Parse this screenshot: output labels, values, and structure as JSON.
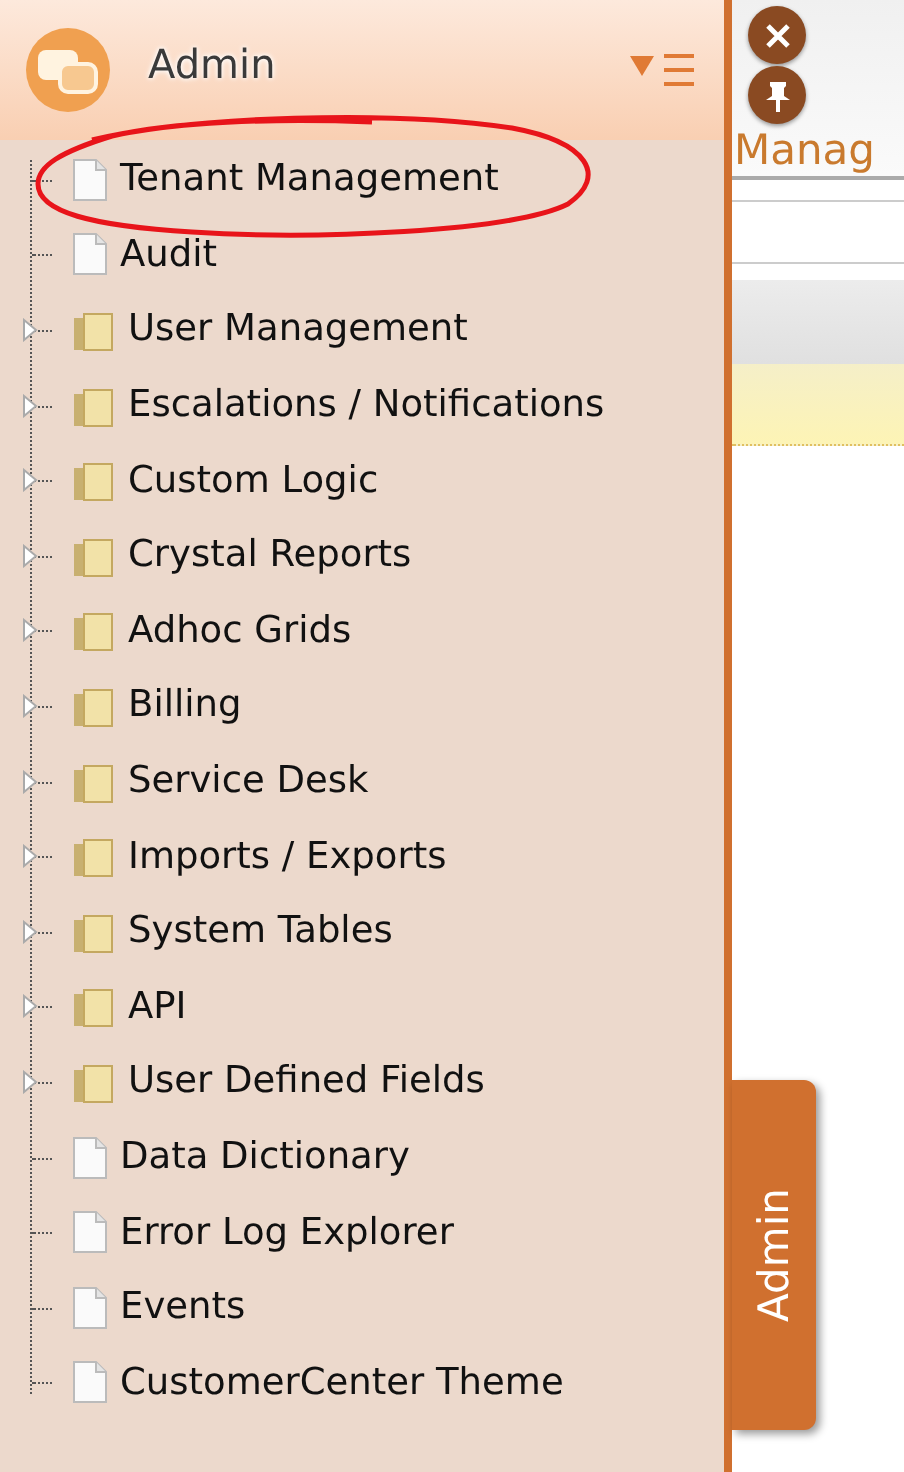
{
  "panel": {
    "title": "Admin",
    "tree": [
      {
        "label": "Tenant Management",
        "kind": "page"
      },
      {
        "label": "Audit",
        "kind": "page"
      },
      {
        "label": "User Management",
        "kind": "folder"
      },
      {
        "label": "Escalations / Notifications",
        "kind": "folder"
      },
      {
        "label": "Custom Logic",
        "kind": "folder"
      },
      {
        "label": "Crystal Reports",
        "kind": "folder"
      },
      {
        "label": "Adhoc Grids",
        "kind": "folder"
      },
      {
        "label": "Billing",
        "kind": "folder"
      },
      {
        "label": "Service Desk",
        "kind": "folder"
      },
      {
        "label": "Imports / Exports",
        "kind": "folder"
      },
      {
        "label": "System Tables",
        "kind": "folder"
      },
      {
        "label": "API",
        "kind": "folder"
      },
      {
        "label": "User Defined Fields",
        "kind": "folder"
      },
      {
        "label": "Data Dictionary",
        "kind": "page"
      },
      {
        "label": "Error Log Explorer",
        "kind": "page"
      },
      {
        "label": "Events",
        "kind": "page"
      },
      {
        "label": "CustomerCenter Theme",
        "kind": "page"
      }
    ]
  },
  "main": {
    "title": "Manag"
  },
  "side_tab": {
    "label": "Admin"
  }
}
